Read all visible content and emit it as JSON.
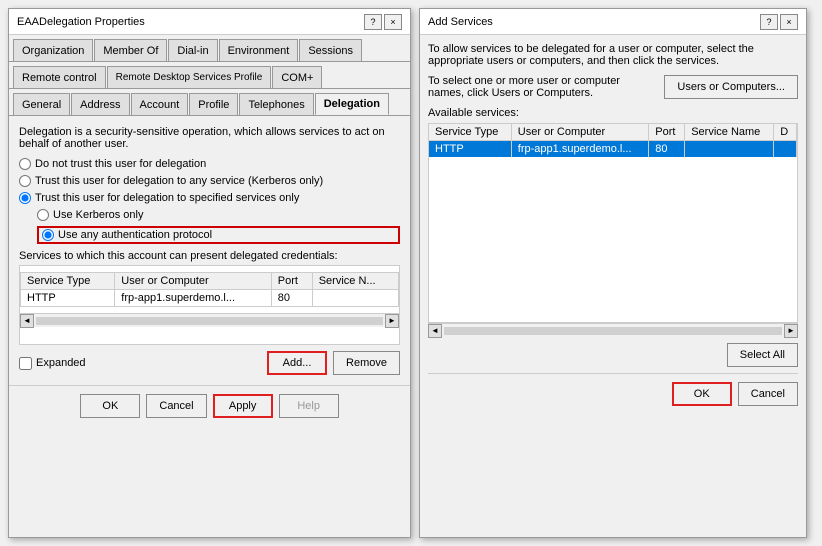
{
  "leftWindow": {
    "title": "EAADelegation Properties",
    "titleBarButtons": [
      "?",
      "×"
    ],
    "tabs": [
      {
        "id": "organization",
        "label": "Organization"
      },
      {
        "id": "member-of",
        "label": "Member Of"
      },
      {
        "id": "dial-in",
        "label": "Dial-in"
      },
      {
        "id": "environment",
        "label": "Environment"
      },
      {
        "id": "sessions",
        "label": "Sessions"
      },
      {
        "id": "remote-control",
        "label": "Remote control"
      },
      {
        "id": "remote-desktop",
        "label": "Remote Desktop Services Profile"
      },
      {
        "id": "com",
        "label": "COM+"
      },
      {
        "id": "general",
        "label": "General"
      },
      {
        "id": "address",
        "label": "Address"
      },
      {
        "id": "account",
        "label": "Account"
      },
      {
        "id": "profile",
        "label": "Profile"
      },
      {
        "id": "telephones",
        "label": "Telephones"
      },
      {
        "id": "delegation",
        "label": "Delegation"
      }
    ],
    "activeTab": "delegation",
    "description": "Delegation is a security-sensitive operation, which allows services to act on behalf of another user.",
    "radioOptions": [
      {
        "id": "no-trust",
        "label": "Do not trust this user for delegation"
      },
      {
        "id": "any-service",
        "label": "Trust this user for delegation to any service (Kerberos only)"
      },
      {
        "id": "specified",
        "label": "Trust this user for delegation to specified services only",
        "checked": true
      }
    ],
    "subRadioOptions": [
      {
        "id": "kerberos-only",
        "label": "Use Kerberos only"
      },
      {
        "id": "any-auth",
        "label": "Use any authentication protocol",
        "checked": true
      }
    ],
    "tableTitle": "Services to which this account can present delegated credentials:",
    "tableHeaders": [
      "Service Type",
      "User or Computer",
      "Port",
      "Service N..."
    ],
    "tableRows": [
      {
        "serviceType": "HTTP",
        "userOrComputer": "frp-app1.superdemo.l...",
        "port": "80",
        "serviceName": ""
      }
    ],
    "checkboxLabel": "Expanded",
    "checkboxChecked": false,
    "addButton": "Add...",
    "removeButton": "Remove",
    "footerButtons": [
      "OK",
      "Cancel",
      "Apply",
      "Help"
    ]
  },
  "rightWindow": {
    "title": "Add Services",
    "titleBarButtons": [
      "?",
      "×"
    ],
    "introText1": "To allow services to be delegated for a user or computer, select the appropriate users or computers, and then click the services.",
    "introText2": "To select one or more user or computer names, click Users or Computers.",
    "usersComputersButton": "Users or Computers...",
    "availableServicesLabel": "Available services:",
    "tableHeaders": [
      "Service Type",
      "User or Computer",
      "Port",
      "Service Name",
      "D"
    ],
    "tableRows": [
      {
        "serviceType": "HTTP",
        "userOrComputer": "frp-app1.superdemo.l...",
        "port": "80",
        "serviceName": "",
        "d": "",
        "selected": true
      }
    ],
    "selectAllButton": "Select All",
    "okButton": "OK",
    "cancelButton": "Cancel"
  }
}
